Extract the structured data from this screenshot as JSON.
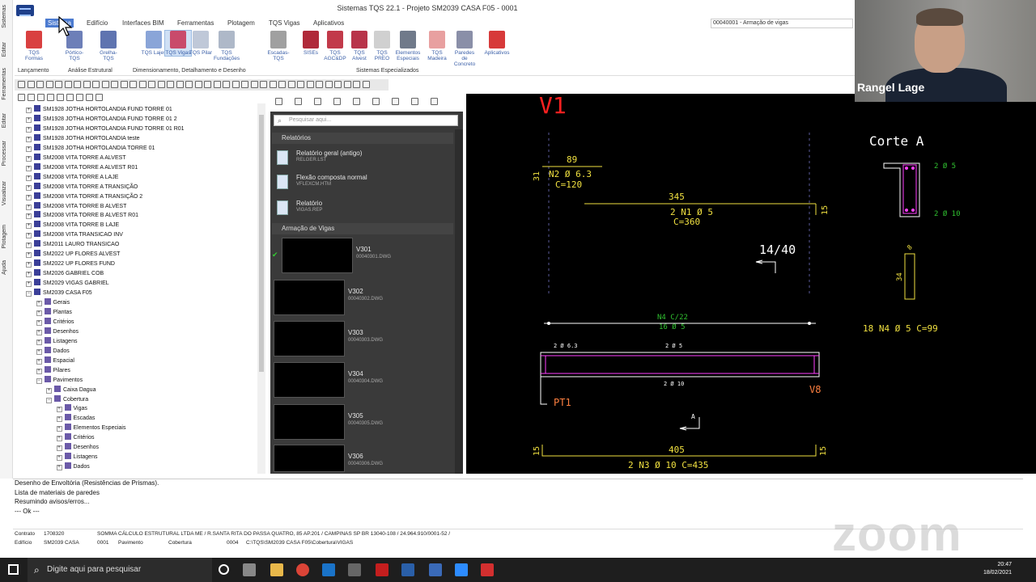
{
  "window": {
    "title": "Sistemas TQS 22.1 - Projeto SM2039 CASA F05 - 0001"
  },
  "menu": {
    "items": [
      "Sistema",
      "Edifício",
      "Interfaces BIM",
      "Ferramentas",
      "Plotagem",
      "TQS Vigas",
      "Aplicativos"
    ],
    "document_combo": "00040001 - Armação de vigas"
  },
  "ribbon": {
    "buttons": [
      {
        "label": "TQS Formas"
      },
      {
        "label": "Pórtico-TQS"
      },
      {
        "label": "Grelha-TQS"
      },
      {
        "label": "TQS Lajes"
      },
      {
        "label": "TQS Vigas"
      },
      {
        "label": "TQS Pilar"
      },
      {
        "label": "TQS Fundações"
      },
      {
        "label": "Escadas-TQS"
      },
      {
        "label": "SISEs"
      },
      {
        "label": "TQS AGC&DP"
      },
      {
        "label": "TQS Alvest"
      },
      {
        "label": "TQS PREO"
      },
      {
        "label": "Elementos Especiais"
      },
      {
        "label": "TQS Madeira"
      },
      {
        "label": "Paredes de Concreto"
      },
      {
        "label": "Aplicativos"
      }
    ],
    "groups": [
      "Lançamento",
      "Análise Estrutural",
      "Dimensionamento, Detalhamento e Desenho",
      "Sistemas Especializados"
    ]
  },
  "left_tabs": [
    "Sistemas",
    "Editar",
    "Ferramentas",
    "Editar",
    "Processar",
    "Visualizar",
    "Plotagem",
    "Ajuda"
  ],
  "tree": {
    "items": [
      {
        "text": "SM1928 JOTHA HORTOLANDIA FUND TORRE 01",
        "level": 0
      },
      {
        "text": "SM1928 JOTHA HORTOLANDIA FUND TORRE 01 2",
        "level": 0
      },
      {
        "text": "SM1928 JOTHA HORTOLANDIA FUND TORRE 01 R01",
        "level": 0
      },
      {
        "text": "SM1928 JOTHA HORTOLANDIA teste",
        "level": 0
      },
      {
        "text": "SM1928 JOTHA HORTOLANDIA TORRE 01",
        "level": 0
      },
      {
        "text": "SM2008 VITA TORRE A ALVEST",
        "level": 0
      },
      {
        "text": "SM2008 VITA TORRE A ALVEST R01",
        "level": 0
      },
      {
        "text": "SM2008 VITA TORRE A LAJE",
        "level": 0
      },
      {
        "text": "SM2008 VITA TORRE A TRANSIÇÃO",
        "level": 0
      },
      {
        "text": "SM2008 VITA TORRE A TRANSIÇÃO 2",
        "level": 0
      },
      {
        "text": "SM2008 VITA TORRE B ALVEST",
        "level": 0
      },
      {
        "text": "SM2008 VITA TORRE B ALVEST R01",
        "level": 0
      },
      {
        "text": "SM2008 VITA TORRE B LAJE",
        "level": 0
      },
      {
        "text": "SM2008 VITA TRANSICAO INV",
        "level": 0
      },
      {
        "text": "SM2011 LAURO TRANSICAO",
        "level": 0
      },
      {
        "text": "SM2022 UP FLORES ALVEST",
        "level": 0
      },
      {
        "text": "SM2022 UP FLORES FUND",
        "level": 0
      },
      {
        "text": "SM2026 GABRIEL COB",
        "level": 0
      },
      {
        "text": "SM2029 VIGAS GABRIEL",
        "level": 0
      },
      {
        "text": "SM2039 CASA F05",
        "level": 0
      },
      {
        "text": "Gerais",
        "level": 1
      },
      {
        "text": "Plantas",
        "level": 1
      },
      {
        "text": "Critérios",
        "level": 1
      },
      {
        "text": "Desenhos",
        "level": 1
      },
      {
        "text": "Listagens",
        "level": 1
      },
      {
        "text": "Dados",
        "level": 1
      },
      {
        "text": "Espacial",
        "level": 1
      },
      {
        "text": "Pilares",
        "level": 1
      },
      {
        "text": "Pavimentos",
        "level": 1
      },
      {
        "text": "Caixa Dagua",
        "level": 2
      },
      {
        "text": "Cobertura",
        "level": 2
      },
      {
        "text": "Vigas",
        "level": 3
      },
      {
        "text": "Escadas",
        "level": 3
      },
      {
        "text": "Elementos Especiais",
        "level": 3
      },
      {
        "text": "Critérios",
        "level": 3
      },
      {
        "text": "Desenhos",
        "level": 3
      },
      {
        "text": "Listagens",
        "level": 3
      },
      {
        "text": "Dados",
        "level": 3
      }
    ]
  },
  "mid": {
    "search_placeholder": "Pesquisar aqui...",
    "sections": [
      "Relatórios",
      "Armação de Vigas"
    ],
    "reports": [
      {
        "title": "Relatório geral (antigo)",
        "file": "RELGER.LST"
      },
      {
        "title": "Flexão composta normal",
        "file": "VFLEXCM.HTM"
      },
      {
        "title": "Relatório",
        "file": "VIGAS.REP"
      }
    ],
    "drawings": [
      {
        "name": "V301",
        "file": "00040301.DWG"
      },
      {
        "name": "V302",
        "file": "00040302.DWG"
      },
      {
        "name": "V303",
        "file": "00040303.DWG"
      },
      {
        "name": "V304",
        "file": "00040304.DWG"
      },
      {
        "name": "V305",
        "file": "00040305.DWG"
      },
      {
        "name": "V306",
        "file": "00040306.DWG"
      }
    ]
  },
  "cad": {
    "beam_title": "V1",
    "n2_len": "89",
    "n2_label": "N2 Ø 6.3",
    "n2_c": "C=120",
    "n2_hook": "31",
    "n1_len": "345",
    "n1_label": "2 N1 Ø 5",
    "n1_c": "C=360",
    "n1_end": "15",
    "section": "14/40",
    "n4_label": "N4 C/22",
    "n4_count": "16 Ø 5",
    "top_label_left": "2 Ø 6.3",
    "top_label_mid": "2 Ø 5",
    "bottom_label": "2 Ø 10",
    "pt1": "PT1",
    "v8": "V8",
    "cut_a": "A",
    "n3_len": "405",
    "n3_label": "2 N3 Ø 10 C=435",
    "n3_end_l": "15",
    "n3_end_r": "15",
    "corte_title": "Corte A",
    "corte_top": "2 Ø 5",
    "corte_bottom": "2 Ø 10",
    "stirrup_h": "34",
    "stirrup_w": "8",
    "n4_full": "18 N4 Ø 5 C=99"
  },
  "console": {
    "lines": [
      "Desenho de Envoltória (Resistências de Prismas).",
      "Lista de materiais de paredes",
      "Resumindo avisos/erros...",
      "--- Ok ---"
    ]
  },
  "status": {
    "contrato_label": "Contrato",
    "contrato_value": "1708320",
    "company": "SOMMA CÁLCULO ESTRUTURAL LTDA ME / R.SANTA RITA DO PASSA QUATRO, 85 AP.201 / CAMPINAS SP BR 13040-108 / 24.964.910/0001-52 /",
    "edificio_label": "Edifício",
    "edificio_value": "SM2039 CASA",
    "pav_num": "0001",
    "pav_label": "Pavimento",
    "pav_value": "Cobertura",
    "path_num": "0004",
    "path": "C:\\TQS\\SM2039 CASA F05\\Cobertura\\VIGAS"
  },
  "taskbar": {
    "search_placeholder": "Digite aqui para pesquisar",
    "time": "20:47",
    "date": "18/02/2021"
  },
  "webcam": {
    "name": "Rangel Lage"
  },
  "watermark": "zoom"
}
